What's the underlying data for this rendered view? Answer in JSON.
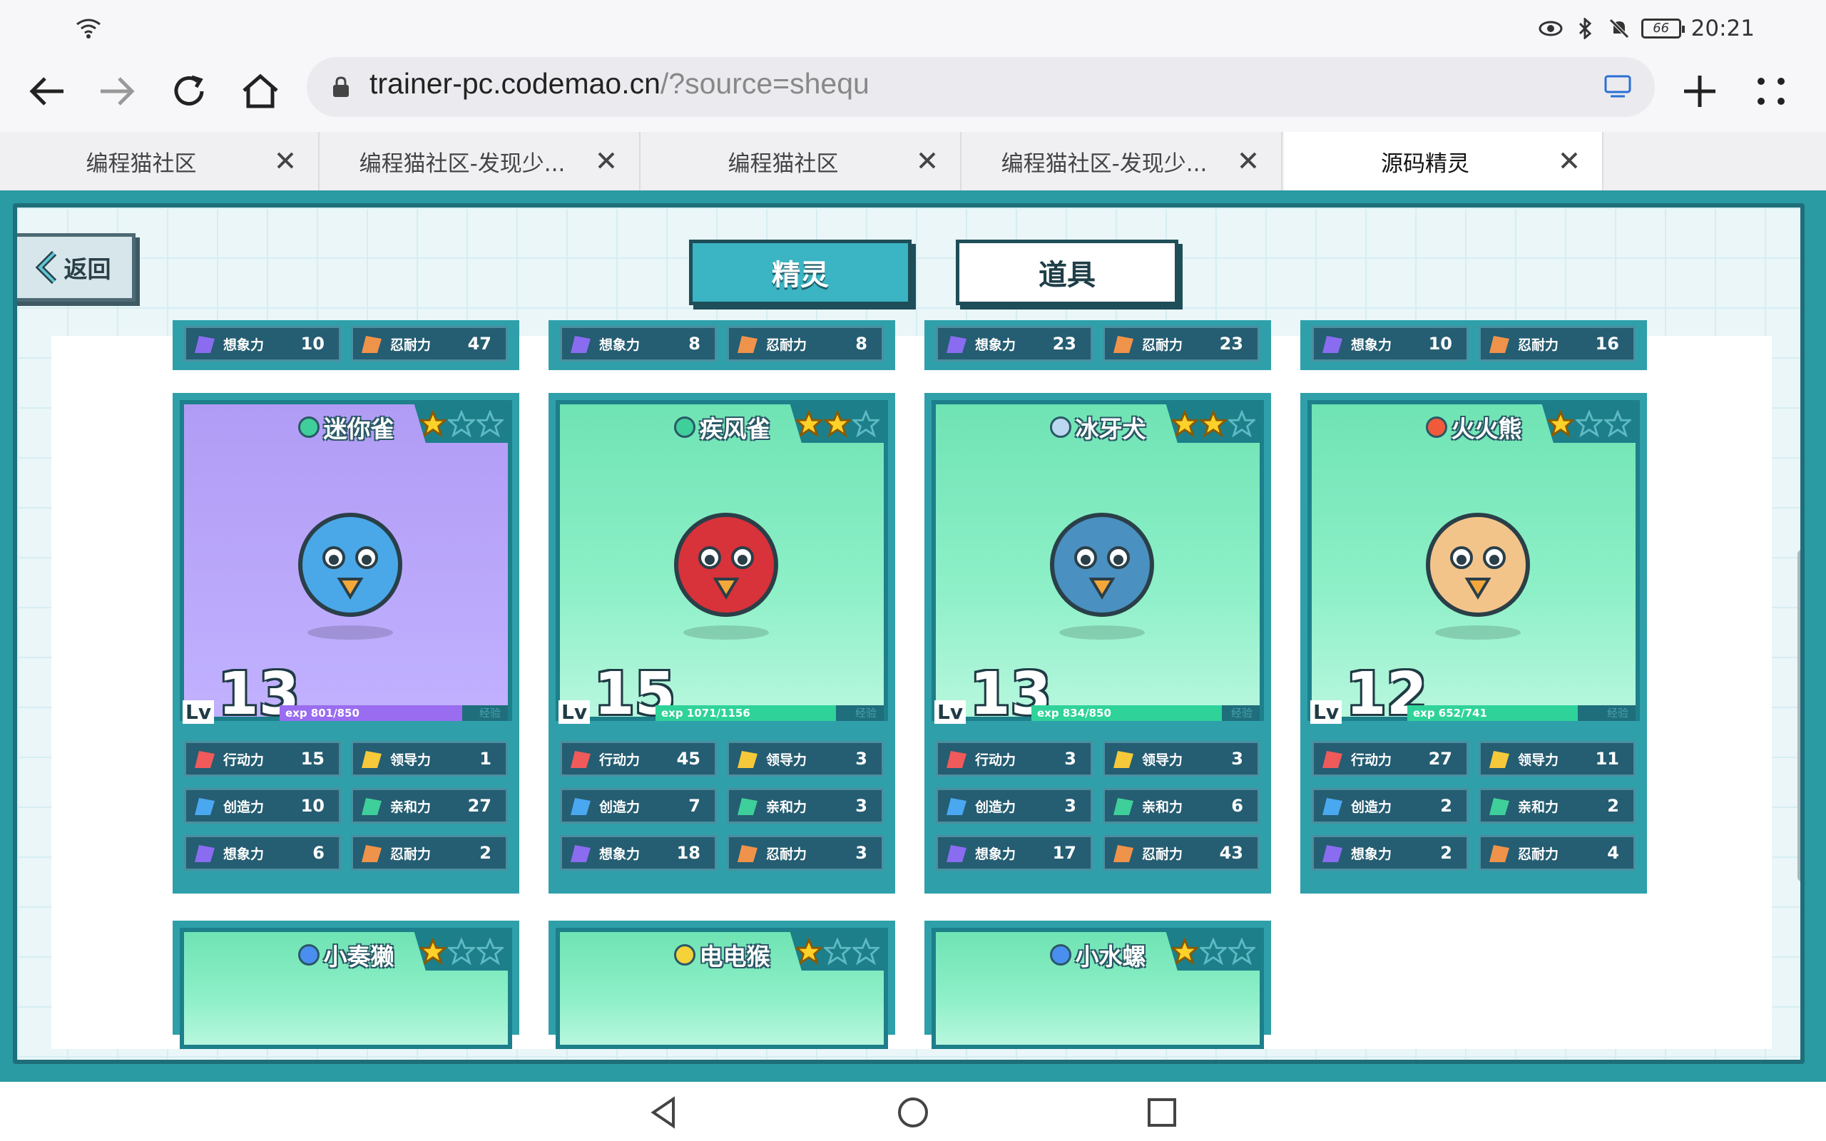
{
  "status_bar": {
    "time": "20:21",
    "battery": "66"
  },
  "browser": {
    "url_host": "trainer-pc.codemao.cn",
    "url_rest": "/?source=shequ",
    "tabs": [
      {
        "title": "编程猫社区"
      },
      {
        "title": "编程猫社区-发现少..."
      },
      {
        "title": "编程猫社区"
      },
      {
        "title": "编程猫社区-发现少..."
      },
      {
        "title": "源码精灵",
        "active": true
      }
    ]
  },
  "game": {
    "back_label": "返回",
    "tab_sprites": "精灵",
    "tab_items": "道具",
    "stat_labels": {
      "move": "行动力",
      "lead": "领导力",
      "create": "创造力",
      "friend": "亲和力",
      "imagine": "想象力",
      "endure": "忍耐力"
    },
    "lv_label": "Lv",
    "exp_tag": "经验",
    "top_row": [
      {
        "imagine": "10",
        "endure": "47"
      },
      {
        "imagine": "8",
        "endure": "8"
      },
      {
        "imagine": "23",
        "endure": "23"
      },
      {
        "imagine": "10",
        "endure": "16"
      }
    ],
    "cards": [
      {
        "name": "迷你雀",
        "element": "wind",
        "stars": 1,
        "bg": "purple",
        "level": "13",
        "exp": "exp 801/850",
        "exp_fraction": 0.94,
        "move": "15",
        "lead": "1",
        "create": "10",
        "friend": "27",
        "imagine": "6",
        "endure": "2"
      },
      {
        "name": "疾风雀",
        "element": "wind",
        "stars": 2,
        "bg": "green",
        "level": "15",
        "exp": "exp 1071/1156",
        "exp_fraction": 0.93,
        "move": "45",
        "lead": "3",
        "create": "7",
        "friend": "3",
        "imagine": "18",
        "endure": "3"
      },
      {
        "name": "冰牙犬",
        "element": "ice",
        "stars": 2,
        "bg": "green",
        "level": "13",
        "exp": "exp 834/850",
        "exp_fraction": 0.98,
        "move": "3",
        "lead": "3",
        "create": "3",
        "friend": "6",
        "imagine": "17",
        "endure": "43"
      },
      {
        "name": "火火熊",
        "element": "fire",
        "stars": 1,
        "bg": "green",
        "level": "12",
        "exp": "exp 652/741",
        "exp_fraction": 0.88,
        "move": "27",
        "lead": "11",
        "create": "2",
        "friend": "2",
        "imagine": "2",
        "endure": "4"
      }
    ],
    "bottom_row": [
      {
        "name": "小奏獭",
        "element": "water",
        "stars": 1
      },
      {
        "name": "电电猴",
        "element": "electric",
        "stars": 1
      },
      {
        "name": "小水螺",
        "element": "water",
        "stars": 1
      }
    ]
  },
  "colors": {
    "accent": "#3bb4c3",
    "frame": "#2a9aa3",
    "exp_green": "#2fd39a",
    "exp_purple": "#9a6cf0"
  }
}
